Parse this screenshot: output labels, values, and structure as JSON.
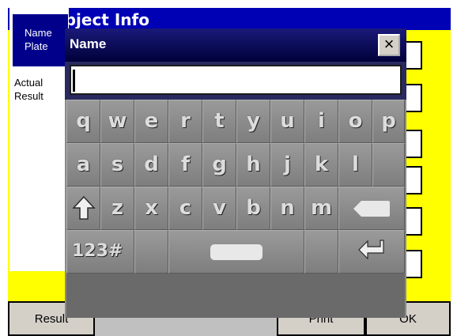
{
  "app": {
    "title": "Test object Info",
    "name_plate_label": "Name\nPlate",
    "actual_result_label": "Actual\nResult"
  },
  "bottom_bar": {
    "result_label": "Result",
    "print_label": "Print",
    "ok_label": "OK"
  },
  "dialog": {
    "title": "Name",
    "close_label": "×",
    "input_value": ""
  },
  "keyboard": {
    "row1": [
      "q",
      "w",
      "e",
      "r",
      "t",
      "y",
      "u",
      "i",
      "o",
      "p"
    ],
    "row2": [
      "a",
      "s",
      "d",
      "f",
      "g",
      "h",
      "j",
      "k",
      "l"
    ],
    "row3": [
      "z",
      "x",
      "c",
      "v",
      "b",
      "n",
      "m"
    ],
    "mode_key_label": "123#",
    "shift_icon": "shift-up-arrow-icon",
    "backspace_icon": "backspace-icon",
    "space_icon": "space-bar-icon",
    "enter_icon": "enter-return-icon"
  },
  "colors": {
    "title_blue": "#0000b4",
    "highlight_yellow": "#ffff00",
    "dialog_gray": "#8a8a8a"
  }
}
